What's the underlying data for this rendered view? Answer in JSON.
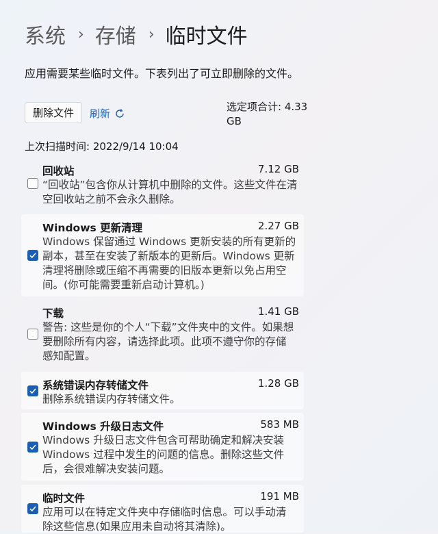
{
  "breadcrumb": {
    "items": [
      "系统",
      "存储",
      "临时文件"
    ]
  },
  "description": "应用需要某些临时文件。下表列出了可立即删除的文件。",
  "toolbar": {
    "delete_label": "删除文件",
    "refresh_label": "刷新",
    "total_line1": "选定项合计: 4.33",
    "total_line2": "GB"
  },
  "scan_time": "上次扫描时间: 2022/9/14 10:04",
  "items": [
    {
      "title": "回收站",
      "size": "7.12 GB",
      "checked": false,
      "lines": [
        "“回收站”包含你从计算机中删除的文件。这些文件在清",
        "空回收站之前不会永久删除。"
      ]
    },
    {
      "title": "Windows 更新清理",
      "size": "2.27 GB",
      "checked": true,
      "lines": [
        "Windows 保留通过 Windows 更新安装的所有更新的",
        "副本，甚至在安装了新版本的更新后。Windows 更新",
        "清理将删除或压缩不再需要的旧版本更新以免占用空",
        "间。(你可能需要重新启动计算机。)"
      ]
    },
    {
      "title": "下载",
      "size": "1.41 GB",
      "checked": false,
      "lines": [
        "警告: 这些是你的个人“下载”文件夹中的文件。如果想",
        "要删除所有内容，请选择此项。此项不遵守你的存储",
        "感知配置。"
      ]
    },
    {
      "title": "系统错误内存转储文件",
      "size": "1.28 GB",
      "checked": true,
      "lines": [
        "删除系统错误内存转储文件。"
      ]
    },
    {
      "title": "Windows 升级日志文件",
      "size": "583 MB",
      "checked": true,
      "lines": [
        "Windows 升级日志文件包含可帮助确定和解决安装",
        "Windows 过程中发生的问题的信息。删除这些文件",
        "后，会很难解决安装问题。"
      ]
    },
    {
      "title": "临时文件",
      "size": "191 MB",
      "checked": true,
      "lines": [
        "应用可以在特定文件夹中存储临时信息。可以手动清",
        "除这些信息(如果应用未自动将其清除)。"
      ]
    }
  ],
  "colors": {
    "accent": "#1a5fb4",
    "link": "#1f5fb0"
  }
}
